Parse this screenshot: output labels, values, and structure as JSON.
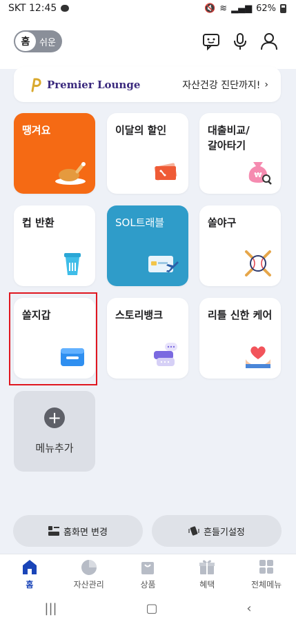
{
  "status_bar": {
    "carrier_time": "SKT 12:45",
    "battery": "62%"
  },
  "header": {
    "mode_toggle": {
      "active": "홈",
      "inactive": "쉬운"
    }
  },
  "lounge": {
    "brand": "Premier Lounge",
    "link_text": "자산건강 진단까지!"
  },
  "tiles": [
    {
      "label": "땡겨요",
      "icon": "roast-chicken-icon"
    },
    {
      "label": "이달의 할인",
      "icon": "coupon-icon"
    },
    {
      "label": "대출비교/\n갈아타기",
      "icon": "money-bag-search-icon"
    },
    {
      "label": "컵 반환",
      "icon": "cup-icon"
    },
    {
      "label": "SOL트래블",
      "icon": "card-plane-icon"
    },
    {
      "label": "쏠야구",
      "icon": "baseball-icon"
    },
    {
      "label": "쏠지갑",
      "icon": "wallet-icon"
    },
    {
      "label": "스토리뱅크",
      "icon": "chat-bubbles-icon"
    },
    {
      "label": "리틀 신한 케어",
      "icon": "heart-hands-icon"
    }
  ],
  "add_menu": {
    "label": "메뉴추가"
  },
  "actions": {
    "change_home": "홈화면 변경",
    "shake_settings": "흔들기설정"
  },
  "nav": [
    {
      "label": "홈",
      "icon": "home-icon",
      "active": true
    },
    {
      "label": "자산관리",
      "icon": "pie-chart-icon",
      "active": false
    },
    {
      "label": "상품",
      "icon": "shopping-bag-icon",
      "active": false
    },
    {
      "label": "혜택",
      "icon": "gift-icon",
      "active": false
    },
    {
      "label": "전체메뉴",
      "icon": "grid-menu-icon",
      "active": false
    }
  ],
  "colors": {
    "accent": "#1a45b8",
    "orange_tile": "#f56a14",
    "blue_tile": "#2f9cc9",
    "highlight": "#e0161f"
  }
}
